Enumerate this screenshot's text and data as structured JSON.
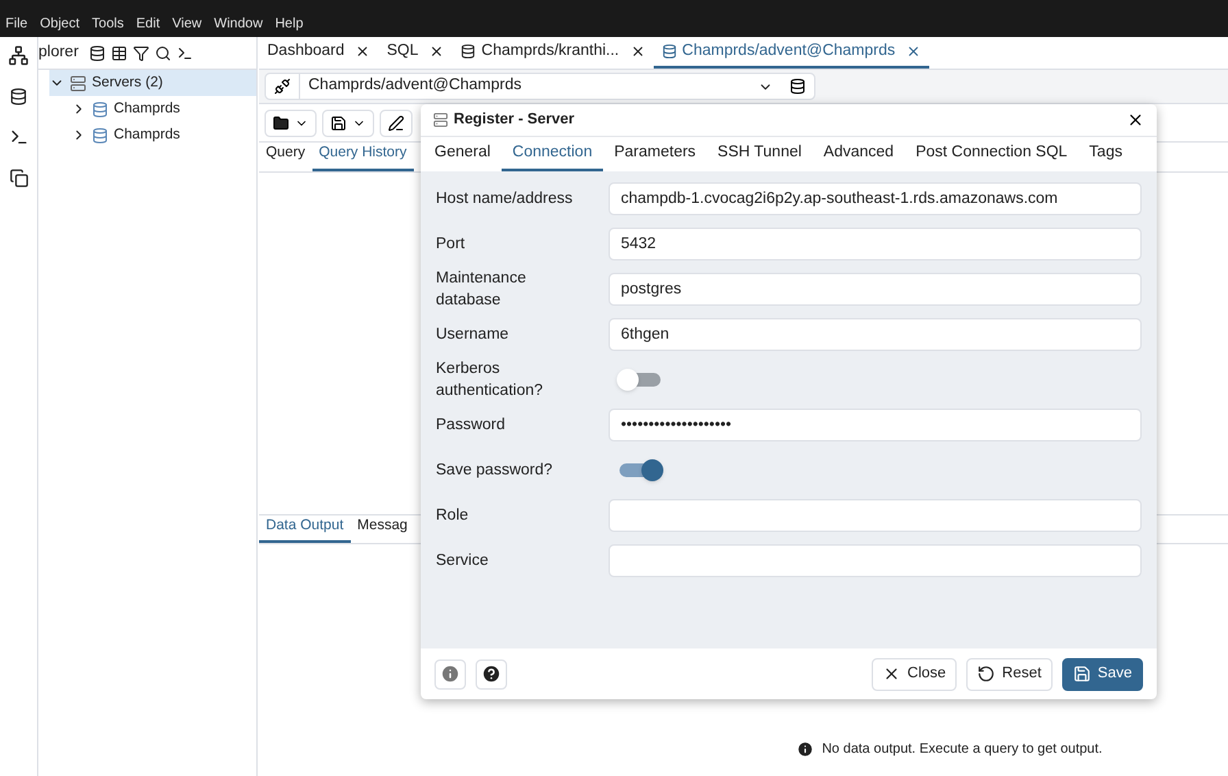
{
  "menu": [
    "File",
    "Object",
    "Tools",
    "Edit",
    "View",
    "Window",
    "Help"
  ],
  "explorer": {
    "title": "plorer",
    "tree": [
      {
        "label": "Servers (2)",
        "expanded": true,
        "selected": true,
        "children": [
          {
            "label": "Champrds",
            "expanded": false
          },
          {
            "label": "Champrds",
            "expanded": false
          }
        ]
      }
    ]
  },
  "tabs": [
    {
      "label": "Dashboard",
      "kind": "plain",
      "selected": false
    },
    {
      "label": "SQL",
      "kind": "plain",
      "selected": false
    },
    {
      "label": "Champrds/kranthi...",
      "kind": "db",
      "selected": false
    },
    {
      "label": "Champrds/advent@Champrds",
      "kind": "db",
      "selected": true
    }
  ],
  "connection": "Champrds/advent@Champrds",
  "query_tabs": [
    {
      "label": "Query",
      "selected": false
    },
    {
      "label": "Query History",
      "selected": true
    }
  ],
  "output_tabs": [
    {
      "label": "Data Output",
      "selected": true
    },
    {
      "label": "Messag",
      "selected": false
    }
  ],
  "output_message": "No data output. Execute a query to get output.",
  "dialog": {
    "title": "Register - Server",
    "tabs": [
      {
        "label": "General",
        "selected": false
      },
      {
        "label": "Connection",
        "selected": true
      },
      {
        "label": "Parameters",
        "selected": false
      },
      {
        "label": "SSH Tunnel",
        "selected": false
      },
      {
        "label": "Advanced",
        "selected": false
      },
      {
        "label": "Post Connection SQL",
        "selected": false
      },
      {
        "label": "Tags",
        "selected": false
      }
    ],
    "fields": [
      {
        "label": "Host name/address",
        "kind": "text",
        "value": "champdb-1.cvocag2i6p2y.ap-southeast-1.rds.amazonaws.com"
      },
      {
        "label": "Port",
        "kind": "text",
        "value": "5432"
      },
      {
        "label": "Maintenance database",
        "kind": "text",
        "value": "postgres"
      },
      {
        "label": "Username",
        "kind": "text",
        "value": "6thgen"
      },
      {
        "label": "Kerberos authentication?",
        "kind": "toggle",
        "on": false
      },
      {
        "label": "Password",
        "kind": "text",
        "value": "••••••••••••••••••••"
      },
      {
        "label": "Save password?",
        "kind": "toggle",
        "on": true
      },
      {
        "label": "Role",
        "kind": "text"
      },
      {
        "label": "Service",
        "kind": "text"
      }
    ],
    "buttons": [
      {
        "label": "Close",
        "kind": "close"
      },
      {
        "label": "Reset",
        "kind": "reset"
      },
      {
        "label": "Save",
        "kind": "save"
      }
    ]
  }
}
